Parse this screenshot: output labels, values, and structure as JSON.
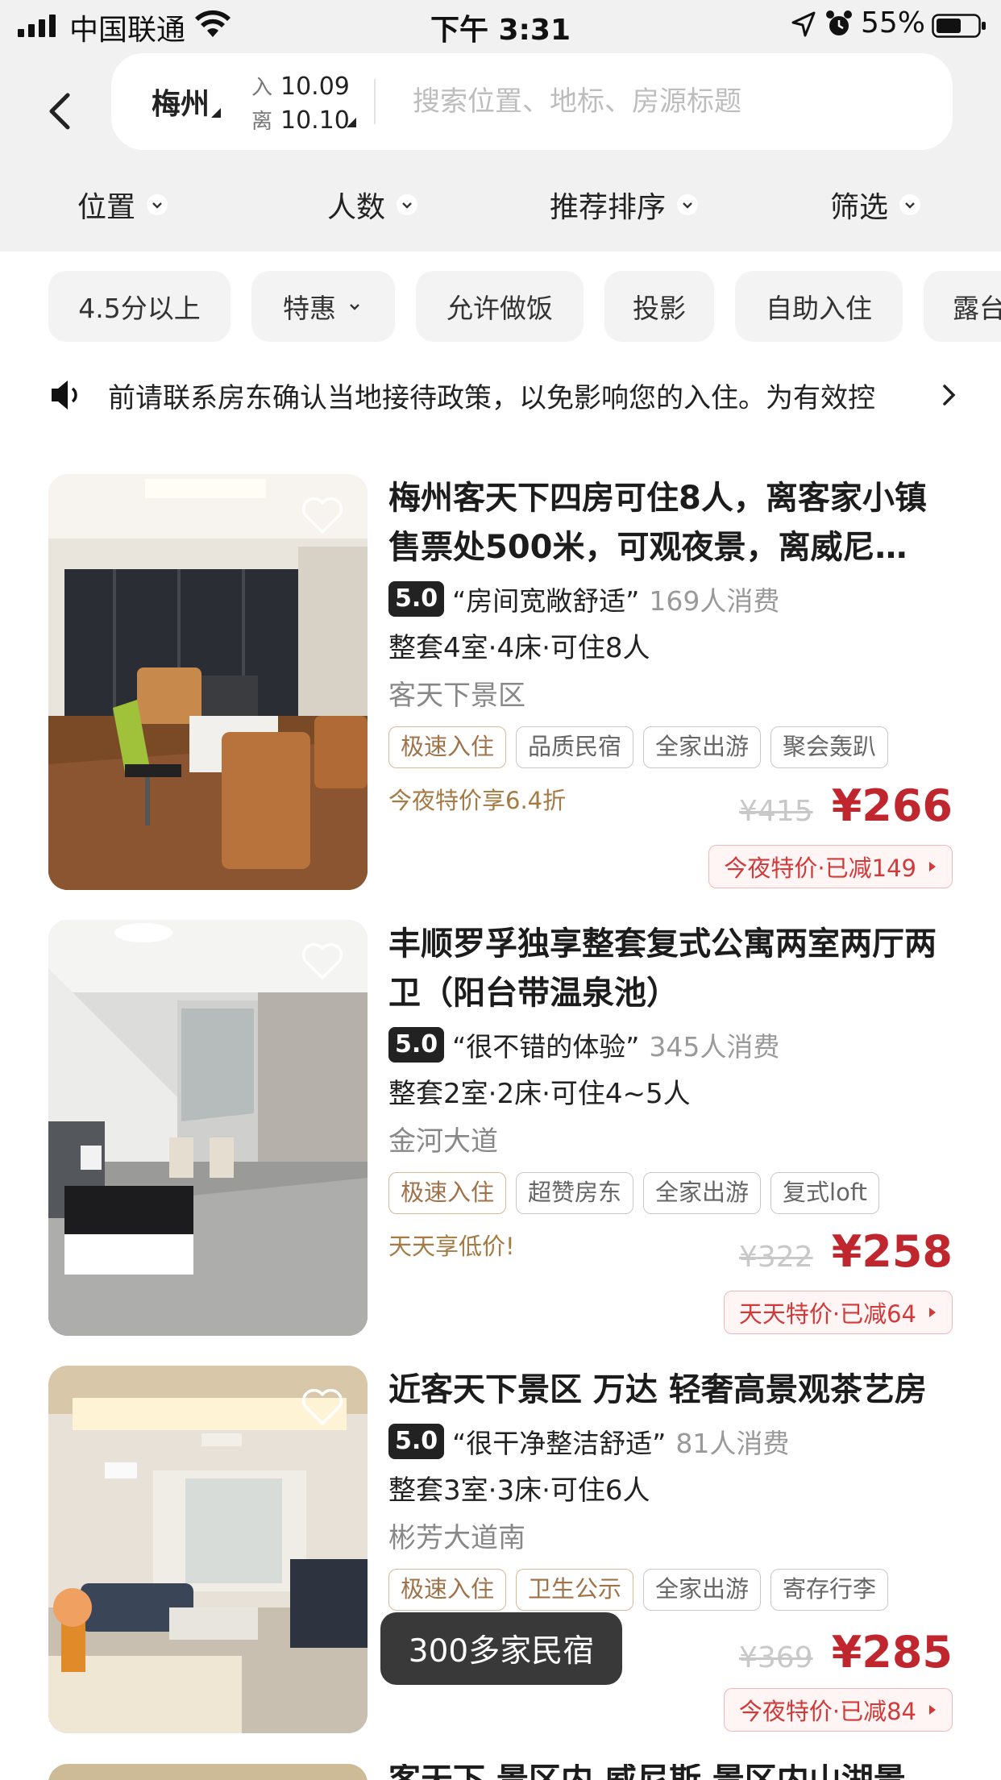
{
  "status_bar": {
    "carrier": "中国联通",
    "time": "下午 3:31",
    "battery": "55%"
  },
  "search": {
    "city": "梅州",
    "checkin_label": "入",
    "checkin_date": "10.09",
    "checkout_label": "离",
    "checkout_date": "10.10",
    "placeholder": "搜索位置、地标、房源标题"
  },
  "filters": [
    "位置",
    "人数",
    "推荐排序",
    "筛选"
  ],
  "chips": [
    "4.5分以上",
    "特惠",
    "允许做饭",
    "投影",
    "自助入住",
    "露台"
  ],
  "notice": {
    "text": "前请联系房东确认当地接待政策，以免影响您的入住。为有效控"
  },
  "listings": [
    {
      "title": "梅州客天下四房可住8人，离客家小镇售票处500米，可观夜景，离威尼…",
      "score": "5.0",
      "quote": "“房间宽敞舒适”",
      "consumers": "169人消费",
      "room": "整套4室·4床·可住8人",
      "area": "客天下景区",
      "tags": [
        "极速入住",
        "品质民宿",
        "全家出游",
        "聚会轰趴"
      ],
      "promo": "今夜特价享6.4折",
      "old_price": "¥415",
      "price": "¥266",
      "deal": "今夜特价·已减149"
    },
    {
      "title": "丰顺罗孚独享整套复式公寓两室两厅两卫（阳台带温泉池）",
      "score": "5.0",
      "quote": "“很不错的体验”",
      "consumers": "345人消费",
      "room": "整套2室·2床·可住4~5人",
      "area": "金河大道",
      "tags": [
        "极速入住",
        "超赞房东",
        "全家出游",
        "复式loft"
      ],
      "promo": "天天享低价!",
      "old_price": "¥322",
      "price": "¥258",
      "deal": "天天特价·已减64"
    },
    {
      "title": "近客天下景区 万达 轻奢高景观茶艺房",
      "score": "5.0",
      "quote": "“很干净整洁舒适”",
      "consumers": "81人消费",
      "room": "整套3室·3床·可住6人",
      "area": "彬芳大道南",
      "tags": [
        "极速入住",
        "卫生公示",
        "全家出游",
        "寄存行李"
      ],
      "promo": "",
      "old_price": "¥369",
      "price": "¥285",
      "deal": "今夜特价·已减84"
    }
  ],
  "toast": "300多家民宿",
  "next_listing_title": "客天下 景区内 威尼斯 景区内山湖景",
  "colors": {
    "accent_red": "#c0262d",
    "promo_gold": "#a57a43",
    "header_bg": "#f1f1f1"
  }
}
